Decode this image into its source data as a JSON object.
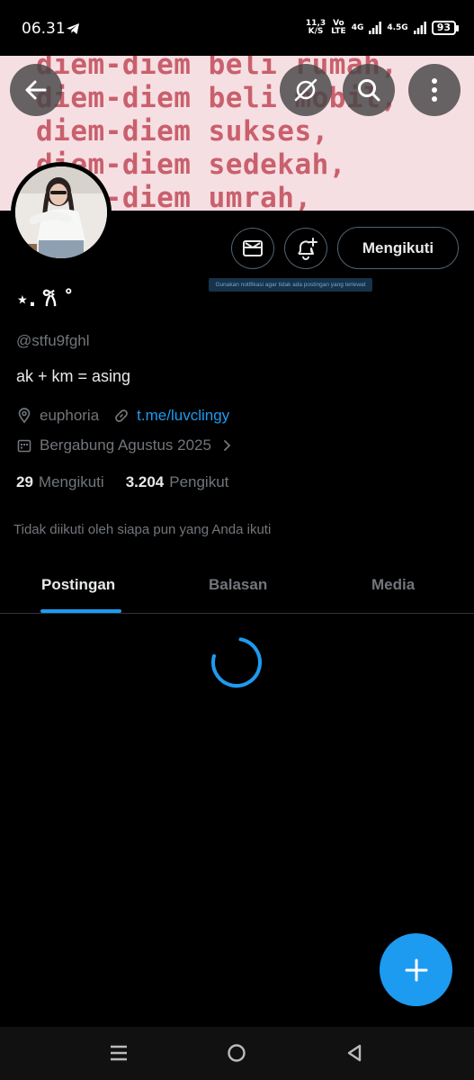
{
  "status": {
    "time": "06.31",
    "speed_value": "11,3",
    "speed_unit": "K/S",
    "volte_top": "Vo",
    "volte_bottom": "LTE",
    "net_1": "4G",
    "net_2": "4.5G",
    "battery": "93"
  },
  "banner": {
    "lines": [
      "diem-diem beli rumah,",
      "diem-diem beli mobil,",
      "diem-diem sukses,",
      "diem-diem sedekah,",
      "diem-diem umrah,"
    ]
  },
  "actions": {
    "follow_label": "Mengikuti",
    "notification_tooltip": "Gunakan notifikasi agar tidak ada postingan yang terlewat"
  },
  "profile": {
    "display_name": "⋆. 𐙚 ˚",
    "handle": "@stfu9fghl",
    "bio": "ak + km = asing",
    "location": "euphoria",
    "website": "t.me/luvclingy",
    "joined": "Bergabung Agustus 2025",
    "following_count": "29",
    "following_label": "Mengikuti",
    "followers_count": "3.204",
    "followers_label": "Pengikut",
    "followed_by_note": "Tidak diikuti oleh siapa pun yang Anda ikuti"
  },
  "tabs": [
    {
      "label": "Postingan",
      "active": true
    },
    {
      "label": "Balasan",
      "active": false
    },
    {
      "label": "Media",
      "active": false
    }
  ],
  "colors": {
    "accent": "#1d9bf0",
    "banner_bg": "#f6dfe2",
    "banner_text": "#c9606d"
  }
}
